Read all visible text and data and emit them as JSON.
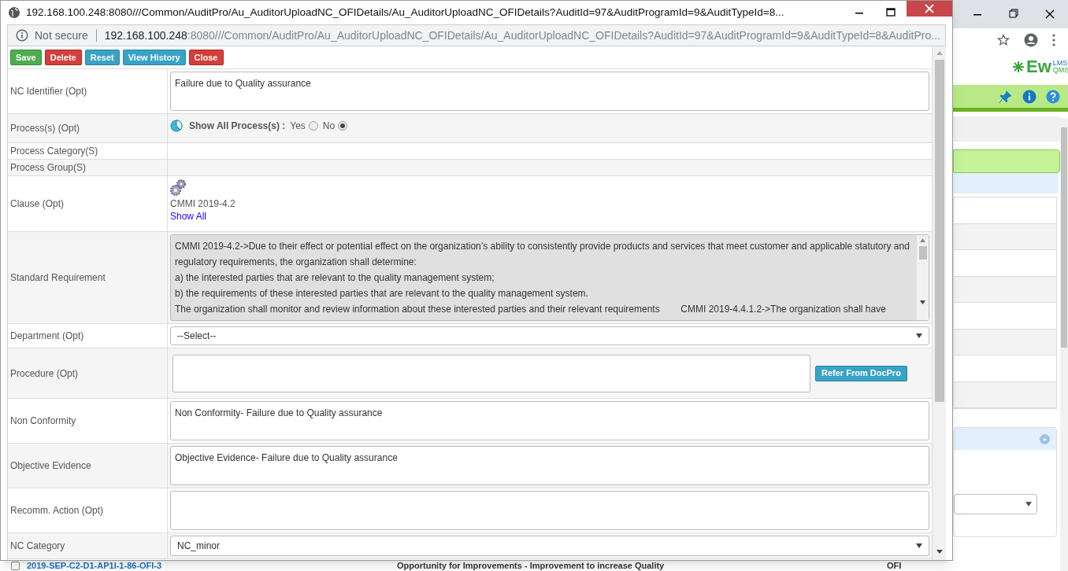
{
  "popup": {
    "title": "192.168.100.248:8080///Common/AuditPro/Au_AuditorUploadNC_OFIDetails/Au_AuditorUploadNC_OFIDetails?AuditId=97&AuditProgramId=9&AuditTypeId=8...",
    "security": "Not secure",
    "url_host": "192.168.100.248",
    "url_rest": ":8080///Common/AuditPro/Au_AuditorUploadNC_OFIDetails/Au_AuditorUploadNC_OFIDetails?AuditId=97&AuditProgramId=9&AuditTypeId=8&AuditPro...",
    "toolbar": [
      {
        "label": "Save",
        "kind": "success"
      },
      {
        "label": "Delete",
        "kind": "danger"
      },
      {
        "label": "Reset",
        "kind": "info"
      },
      {
        "label": "View History",
        "kind": "info"
      },
      {
        "label": "Close",
        "kind": "danger"
      }
    ],
    "rows": [
      {
        "label": "NC Identifier (Opt)",
        "kind": "textarea",
        "value": "Failure due to Quality assurance"
      },
      {
        "label": "Process(s) (Opt)",
        "kind": "radio",
        "question": "Show All Process(s) :",
        "options": [
          {
            "label": "Yes",
            "selected": false
          },
          {
            "label": "No",
            "selected": true
          }
        ]
      },
      {
        "label": "Process Category(S)",
        "kind": "empty"
      },
      {
        "label": "Process Group(S)",
        "kind": "empty"
      },
      {
        "label": "Clause (Opt)",
        "kind": "clause",
        "clause": "CMMI 2019-4.2",
        "link": "Show All"
      },
      {
        "label": "Standard Requirement",
        "kind": "readonly",
        "lines": [
          "CMMI 2019-4.2->Due to their effect or potential effect on the organization’s ability to consistently provide products and services that meet customer and applicable statutory and",
          "regulatory requirements, the organization shall determine:",
          "a) the interested parties that are relevant to the quality management system;",
          "b) the requirements of these interested parties that are relevant to the quality management system.",
          "The organization shall monitor and review information about these interested parties and their relevant requirements        CMMI 2019-4.4.1.2->The organization shall have"
        ]
      },
      {
        "label": "Department (Opt)",
        "kind": "select",
        "value": "--Select--"
      },
      {
        "label": "Procedure (Opt)",
        "kind": "procedure",
        "button": "Refer From DocPro"
      },
      {
        "label": "Non Conformity",
        "kind": "textarea",
        "value": "Non Conformity- Failure due to Quality assurance"
      },
      {
        "label": "Objective Evidence",
        "kind": "textarea",
        "value": "Objective Evidence- Failure due to Quality assurance"
      },
      {
        "label": "Recomm. Action (Opt)",
        "kind": "textarea"
      },
      {
        "label": "NC Category",
        "kind": "select",
        "value": "NC_minor"
      }
    ]
  },
  "background": {
    "logo": "Ew",
    "logo_top": "LMS",
    "logo_bottom": "QMS",
    "row": {
      "checked": false,
      "id": "2019-SEP-C2-D1-AP1I-1-86-OFI-3",
      "description": "Opportunity for Improvements  - Improvement to increase Quality",
      "type": "OFI"
    }
  }
}
